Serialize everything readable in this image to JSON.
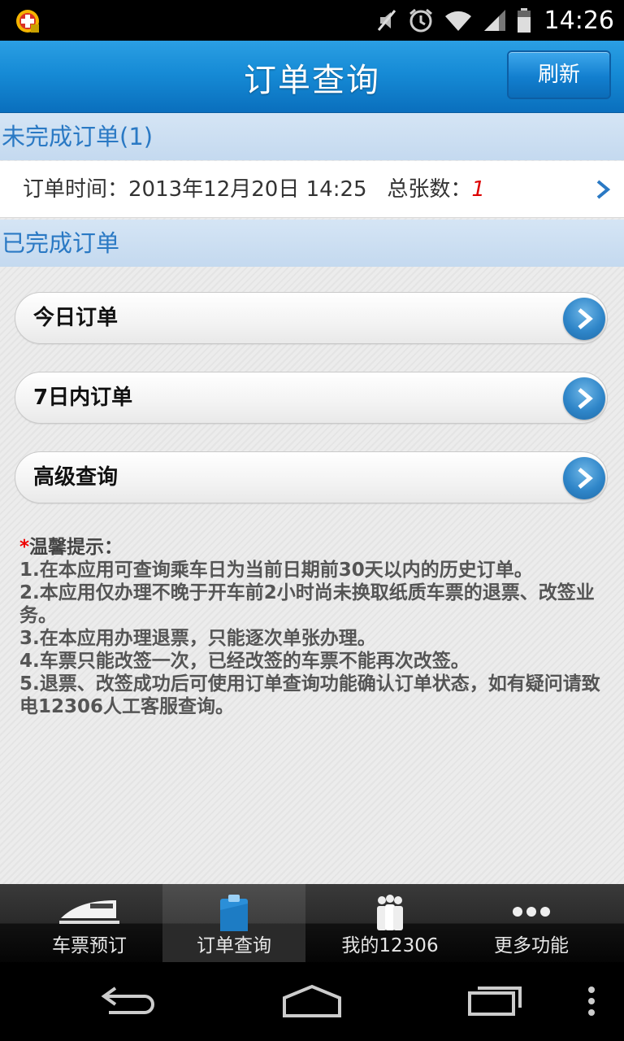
{
  "status_bar": {
    "time": "14:26"
  },
  "header": {
    "title": "订单查询",
    "refresh_label": "刷新"
  },
  "pending": {
    "section_title": "未完成订单(1)",
    "order": {
      "time_label": "订单时间：",
      "time_value": "2013年12月20日 14:25",
      "count_label": "总张数：",
      "count_value": "1"
    }
  },
  "completed": {
    "section_title": "已完成订单",
    "items": [
      {
        "label": "今日订单"
      },
      {
        "label": "7日内订单"
      },
      {
        "label": "高级查询"
      }
    ]
  },
  "tips": {
    "star": "*",
    "title": "温馨提示：",
    "lines": [
      "1.在本应用可查询乘车日为当前日期前30天以内的历史订单。",
      "2.本应用仅办理不晚于开车前2小时尚未换取纸质车票的退票、改签业务。",
      "3.在本应用办理退票，只能逐次单张办理。",
      "4.车票只能改签一次，已经改签的车票不能再次改签。",
      "5.退票、改签成功后可使用订单查询功能确认订单状态，如有疑问请致电12306人工客服查询。"
    ]
  },
  "tabs": [
    {
      "label": "车票预订",
      "icon": "train-icon"
    },
    {
      "label": "订单查询",
      "icon": "clipboard-icon",
      "active": true
    },
    {
      "label": "我的12306",
      "icon": "people-icon"
    },
    {
      "label": "更多功能",
      "icon": "more-dots-icon"
    }
  ],
  "colors": {
    "accent": "#168bd6",
    "section_text": "#2a79c4",
    "count": "#dd0000"
  }
}
